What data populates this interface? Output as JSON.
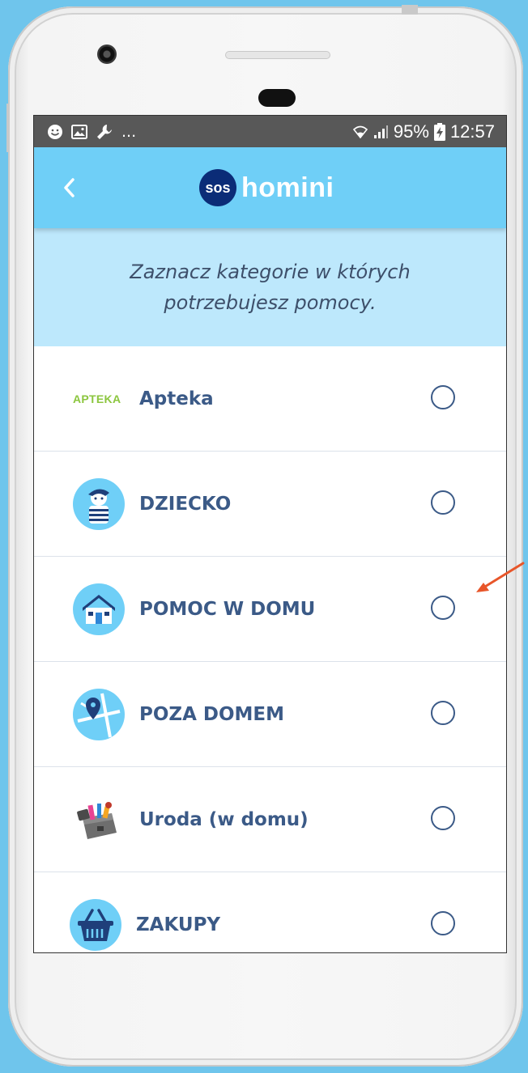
{
  "status_bar": {
    "notification_icons": [
      "smiley-icon",
      "image-icon",
      "wrench-icon"
    ],
    "overflow": "...",
    "battery": "95%",
    "time": "12:57"
  },
  "app_bar": {
    "logo_badge": "sos",
    "logo_text": "homini"
  },
  "banner": {
    "line1": "Zaznacz kategorie w których",
    "line2": "potrzebujesz pomocy."
  },
  "categories": [
    {
      "logo": "APTEKA",
      "label": "Apteka",
      "selected": false
    },
    {
      "icon": "child-icon",
      "label": "DZIECKO",
      "selected": false
    },
    {
      "icon": "house-icon",
      "label": "POMOC W DOMU",
      "selected": false
    },
    {
      "icon": "map-pin-icon",
      "label": "POZA DOMEM",
      "selected": false
    },
    {
      "icon": "beauty-case-icon",
      "label": "Uroda (w domu)",
      "selected": false
    },
    {
      "icon": "shopping-basket-icon",
      "label": "ZAKUPY",
      "selected": false
    }
  ],
  "colors": {
    "background": "#6fc5ec",
    "app_bar": "#6fcff7",
    "banner": "#bde8fc",
    "label_text": "#3b5a87",
    "logo_badge": "#0b2c77",
    "apteka_green": "#8cc63f",
    "annotation_arrow": "#e8562a"
  }
}
